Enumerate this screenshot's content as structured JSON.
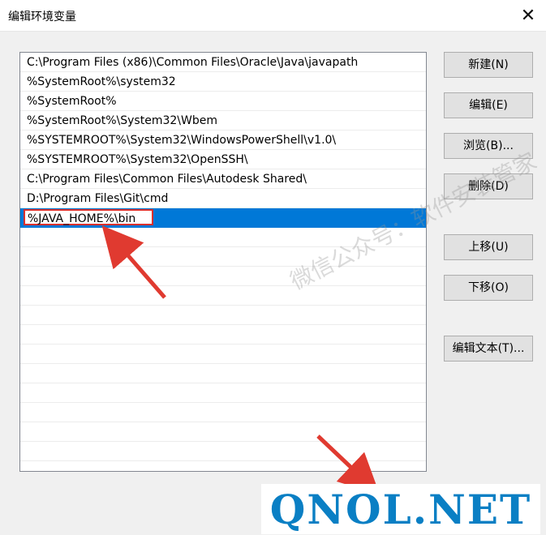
{
  "window": {
    "title": "编辑环境变量",
    "close_glyph": "✕"
  },
  "paths": [
    "C:\\Program Files (x86)\\Common Files\\Oracle\\Java\\javapath",
    "%SystemRoot%\\system32",
    "%SystemRoot%",
    "%SystemRoot%\\System32\\Wbem",
    "%SYSTEMROOT%\\System32\\WindowsPowerShell\\v1.0\\",
    "%SYSTEMROOT%\\System32\\OpenSSH\\",
    "C:\\Program Files\\Common Files\\Autodesk Shared\\",
    "D:\\Program Files\\Git\\cmd",
    "%JAVA_HOME%\\bin"
  ],
  "buttons": {
    "new": "新建(N)",
    "edit": "编辑(E)",
    "browse": "浏览(B)...",
    "delete": "删除(D)",
    "move_up": "上移(U)",
    "move_down": "下移(O)",
    "edit_text": "编辑文本(T)..."
  },
  "watermark": "微信公众号：软件安装管家",
  "logo": "QNOL.NET",
  "colors": {
    "selection": "#0078d7",
    "highlight": "#d9302e",
    "logo": "#0a7fc4"
  }
}
